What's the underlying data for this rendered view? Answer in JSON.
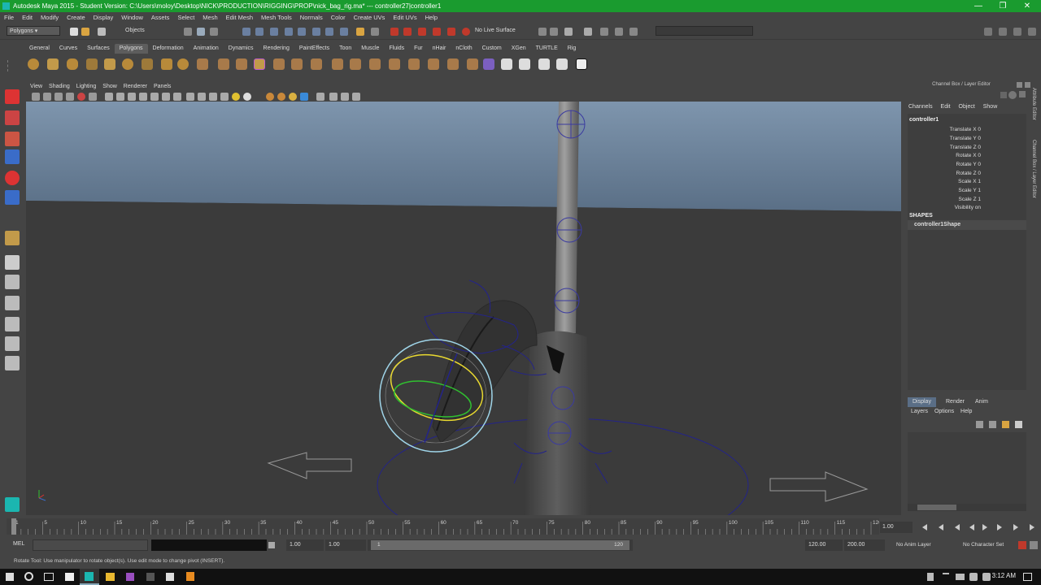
{
  "window": {
    "title": "Autodesk Maya 2015 - Student Version: C:\\Users\\moloy\\Desktop\\NICK\\PRODUCTION\\RIGGING\\PROP\\nick_bag_rig.ma*  ---  controller27|controller1",
    "minimize": "—",
    "restore": "❐",
    "close": "✕"
  },
  "menubar": [
    "File",
    "Edit",
    "Modify",
    "Create",
    "Display",
    "Window",
    "Assets",
    "Select",
    "Mesh",
    "Edit Mesh",
    "Mesh Tools",
    "Normals",
    "Color",
    "Create UVs",
    "Edit UVs",
    "Help"
  ],
  "statusline": {
    "mode": "Polygons",
    "selection_mode": "Objects",
    "live_surface": "No Live Surface"
  },
  "shelf_tabs": [
    "General",
    "Curves",
    "Surfaces",
    "Polygons",
    "Deformation",
    "Animation",
    "Dynamics",
    "Rendering",
    "PaintEffects",
    "Toon",
    "Muscle",
    "Fluids",
    "Fur",
    "nHair",
    "nCloth",
    "Custom",
    "XGen",
    "TURTLE",
    "Rig"
  ],
  "shelf_active": "Polygons",
  "panel_menu": [
    "View",
    "Shading",
    "Lighting",
    "Show",
    "Renderer",
    "Panels"
  ],
  "channel_box": {
    "header": "Channel Box / Layer Editor",
    "menu": [
      "Channels",
      "Edit",
      "Object",
      "Show"
    ],
    "object_name": "controller1",
    "attributes": [
      {
        "name": "Translate X",
        "value": "0"
      },
      {
        "name": "Translate Y",
        "value": "0"
      },
      {
        "name": "Translate Z",
        "value": "0"
      },
      {
        "name": "Rotate X",
        "value": "0"
      },
      {
        "name": "Rotate Y",
        "value": "0"
      },
      {
        "name": "Rotate Z",
        "value": "0"
      },
      {
        "name": "Scale X",
        "value": "1"
      },
      {
        "name": "Scale Y",
        "value": "1"
      },
      {
        "name": "Scale Z",
        "value": "1"
      },
      {
        "name": "Visibility",
        "value": "on"
      }
    ],
    "shapes_label": "SHAPES",
    "shape_name": "controller1Shape",
    "side_tabs": [
      "Attribute Editor",
      "Channel Box / Layer Editor"
    ]
  },
  "layer_editor": {
    "tabs": [
      "Display",
      "Render",
      "Anim"
    ],
    "active_tab": "Display",
    "menu": [
      "Layers",
      "Options",
      "Help"
    ]
  },
  "time_slider": {
    "ticks": [
      "1",
      "5",
      "10",
      "15",
      "20",
      "25",
      "30",
      "35",
      "40",
      "45",
      "50",
      "55",
      "60",
      "65",
      "70",
      "75",
      "80",
      "85",
      "90",
      "95",
      "100",
      "105",
      "110",
      "115",
      "120"
    ],
    "current_frame": "1.00"
  },
  "range_slider": {
    "start_time": "1.00",
    "playback_start": "1.00",
    "range_start_label": "1",
    "range_end_label": "120",
    "playback_end": "120.00",
    "end_time": "200.00",
    "anim_layer": "No Anim Layer",
    "character_set": "No Character Set"
  },
  "command_line": {
    "label": "MEL"
  },
  "help_line": "Rotate Tool: Use manipulator to rotate object(s). Use edit mode to change pivot (INSERT).",
  "taskbar": {
    "time": "3:12 AM"
  },
  "colors": {
    "title_green": "#1a9b2f",
    "viewport_top": "#7e95ad",
    "floor": "#3b3b3b",
    "rig_blue": "#23238a"
  }
}
